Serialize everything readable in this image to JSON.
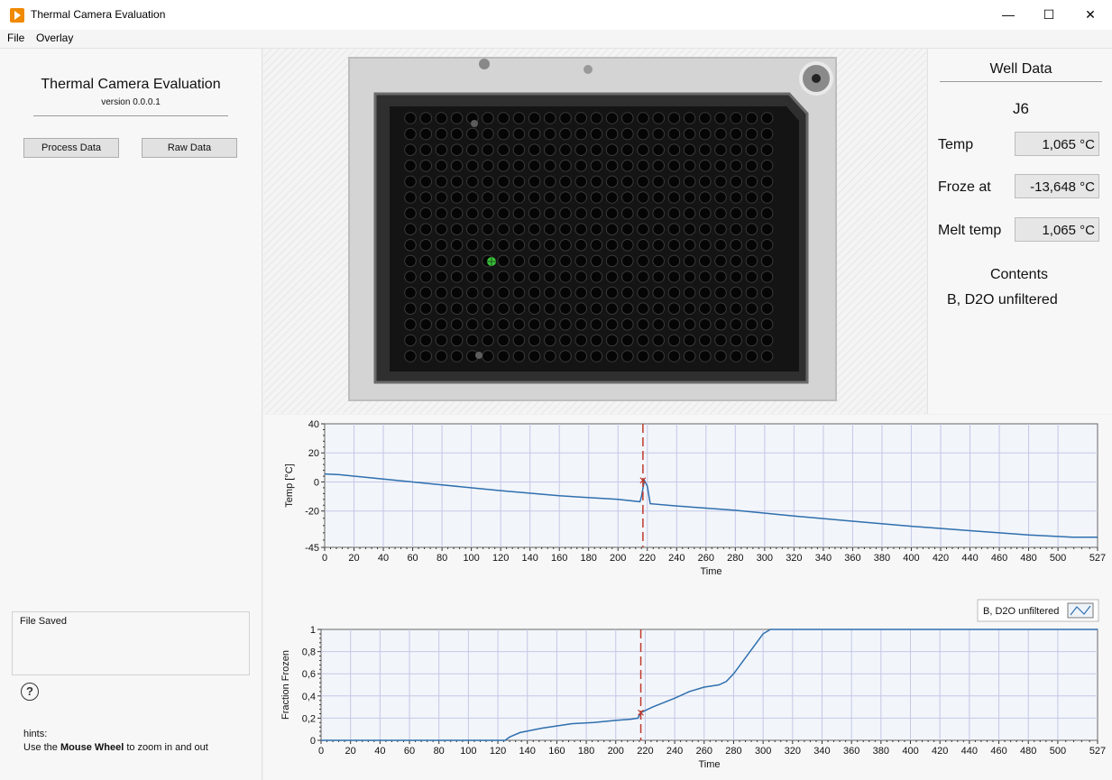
{
  "window": {
    "title": "Thermal Camera Evaluation",
    "min_glyph": "—",
    "max_glyph": "☐",
    "close_glyph": "✕"
  },
  "menu": [
    "File",
    "Overlay"
  ],
  "left": {
    "app_title": "Thermal Camera Evaluation",
    "version": "version 0.0.0.1",
    "process_button": "Process Data",
    "raw_button": "Raw Data",
    "status": "File Saved",
    "help_glyph": "?",
    "hints_title": "hints:",
    "hints_pre": "Use the ",
    "hints_bold": "Mouse Wheel",
    "hints_post": " to zoom in and out"
  },
  "plate": {
    "rows": 16,
    "cols": 24,
    "selected_row": 9,
    "selected_col": 6
  },
  "well": {
    "title": "Well Data",
    "name": "J6",
    "temp_label": "Temp",
    "temp_value": "1,065 °C",
    "froze_label": "Froze at",
    "froze_value": "-13,648 °C",
    "melt_label": "Melt temp",
    "melt_value": "1,065 °C",
    "contents_label": "Contents",
    "contents": "B, D2O unfiltered"
  },
  "colors": {
    "series": "#2e6fae",
    "marker": "#c0392b",
    "grid": "#c4c8e6",
    "plot_bg": "#f2f5fa"
  },
  "chart_data": [
    {
      "type": "line",
      "xlabel": "Time",
      "ylabel": "Temp [°C]",
      "xlim": [
        0,
        527
      ],
      "ylim": [
        -45,
        40
      ],
      "xticks": [
        0,
        20,
        40,
        60,
        80,
        100,
        120,
        140,
        160,
        180,
        200,
        220,
        240,
        260,
        280,
        300,
        320,
        340,
        360,
        380,
        400,
        420,
        440,
        460,
        480,
        500,
        527
      ],
      "yticks": [
        40,
        20,
        0,
        -20,
        -45
      ],
      "grid": true,
      "marker_x": 217,
      "marker_y": 1.1,
      "series": [
        {
          "x": [
            0,
            10,
            40,
            80,
            120,
            160,
            200,
            215,
            216,
            218,
            220,
            222,
            240,
            280,
            320,
            360,
            400,
            440,
            480,
            510,
            527
          ],
          "y": [
            5.5,
            5,
            2,
            -2,
            -6,
            -9.5,
            -12,
            -13.6,
            -10,
            1.1,
            -3,
            -15,
            -16.5,
            -19.5,
            -23.5,
            -27,
            -30.5,
            -33.5,
            -36.5,
            -38,
            -38
          ]
        }
      ]
    },
    {
      "type": "line",
      "xlabel": "Time",
      "ylabel": "Fraction Frozen",
      "xlim": [
        0,
        527
      ],
      "ylim": [
        0,
        1
      ],
      "xticks": [
        0,
        20,
        40,
        60,
        80,
        100,
        120,
        140,
        160,
        180,
        200,
        220,
        240,
        260,
        280,
        300,
        320,
        340,
        360,
        380,
        400,
        420,
        440,
        460,
        480,
        500,
        527
      ],
      "yticks": [
        1,
        0.8,
        0.6,
        0.4,
        0.2,
        0
      ],
      "ytick_labels": [
        "1",
        "0,8",
        "0,6",
        "0,4",
        "0,2",
        "0"
      ],
      "grid": true,
      "legend": "top-right",
      "marker_x": 217,
      "marker_y": 0.25,
      "series": [
        {
          "name": "B, D2O unfiltered",
          "x": [
            0,
            125,
            128,
            135,
            150,
            170,
            185,
            200,
            210,
            215,
            217,
            225,
            240,
            250,
            260,
            270,
            275,
            280,
            290,
            300,
            305,
            527
          ],
          "y": [
            0,
            0,
            0.03,
            0.07,
            0.11,
            0.15,
            0.16,
            0.18,
            0.19,
            0.2,
            0.25,
            0.3,
            0.38,
            0.44,
            0.48,
            0.5,
            0.53,
            0.6,
            0.78,
            0.96,
            1,
            1
          ]
        }
      ]
    }
  ]
}
